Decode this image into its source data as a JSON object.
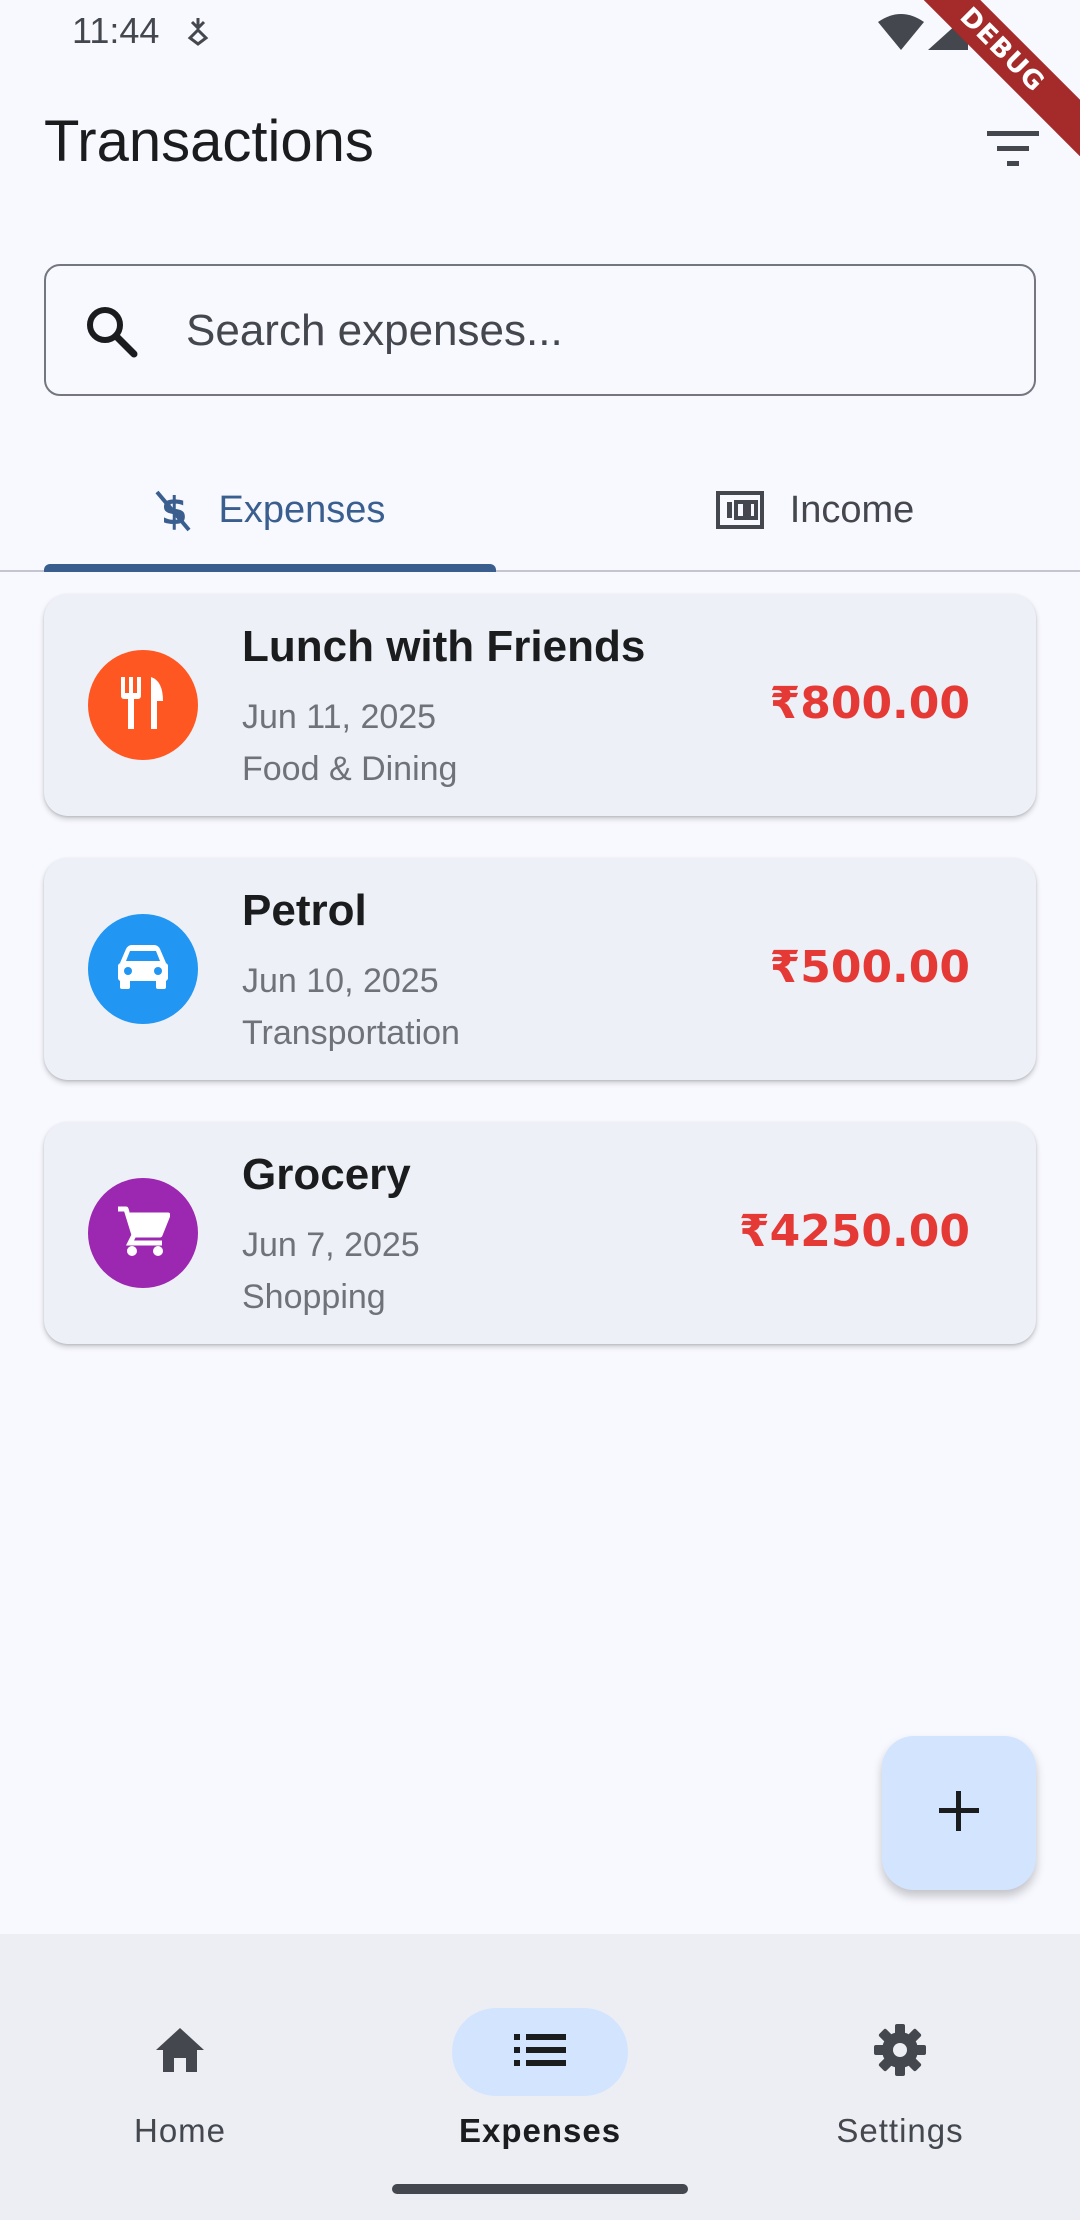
{
  "status_bar": {
    "time": "11:44",
    "icons": [
      "data-saver-icon",
      "wifi-icon",
      "cellular-signal-icon"
    ],
    "debug_banner": "DEBUG"
  },
  "app_bar": {
    "title": "Transactions",
    "filter_icon": "filter-list-icon"
  },
  "search": {
    "placeholder": "Search expenses...",
    "value": "",
    "icon": "search-icon"
  },
  "tabs": [
    {
      "label": "Expenses",
      "icon": "money-off-icon",
      "active": true
    },
    {
      "label": "Income",
      "icon": "money-icon",
      "active": false
    }
  ],
  "transactions": [
    {
      "title": "Lunch with Friends",
      "date": "Jun 11, 2025",
      "category": "Food & Dining",
      "amount": "₹800.00",
      "icon": "restaurant-icon",
      "color": "#ff5722"
    },
    {
      "title": "Petrol",
      "date": "Jun 10, 2025",
      "category": "Transportation",
      "amount": "₹500.00",
      "icon": "car-icon",
      "color": "#2196f3"
    },
    {
      "title": "Grocery",
      "date": "Jun 7, 2025",
      "category": "Shopping",
      "amount": "₹4250.00",
      "icon": "shopping-cart-icon",
      "color": "#9c27b0"
    }
  ],
  "fab": {
    "icon": "add-icon"
  },
  "bottom_nav": [
    {
      "label": "Home",
      "icon": "home-icon",
      "active": false
    },
    {
      "label": "Expenses",
      "icon": "list-icon",
      "active": true
    },
    {
      "label": "Settings",
      "icon": "settings-icon",
      "active": false
    }
  ],
  "colors": {
    "primary": "#3a5f8f",
    "amount": "#e53935",
    "fab_background": "#d3e4ff"
  }
}
